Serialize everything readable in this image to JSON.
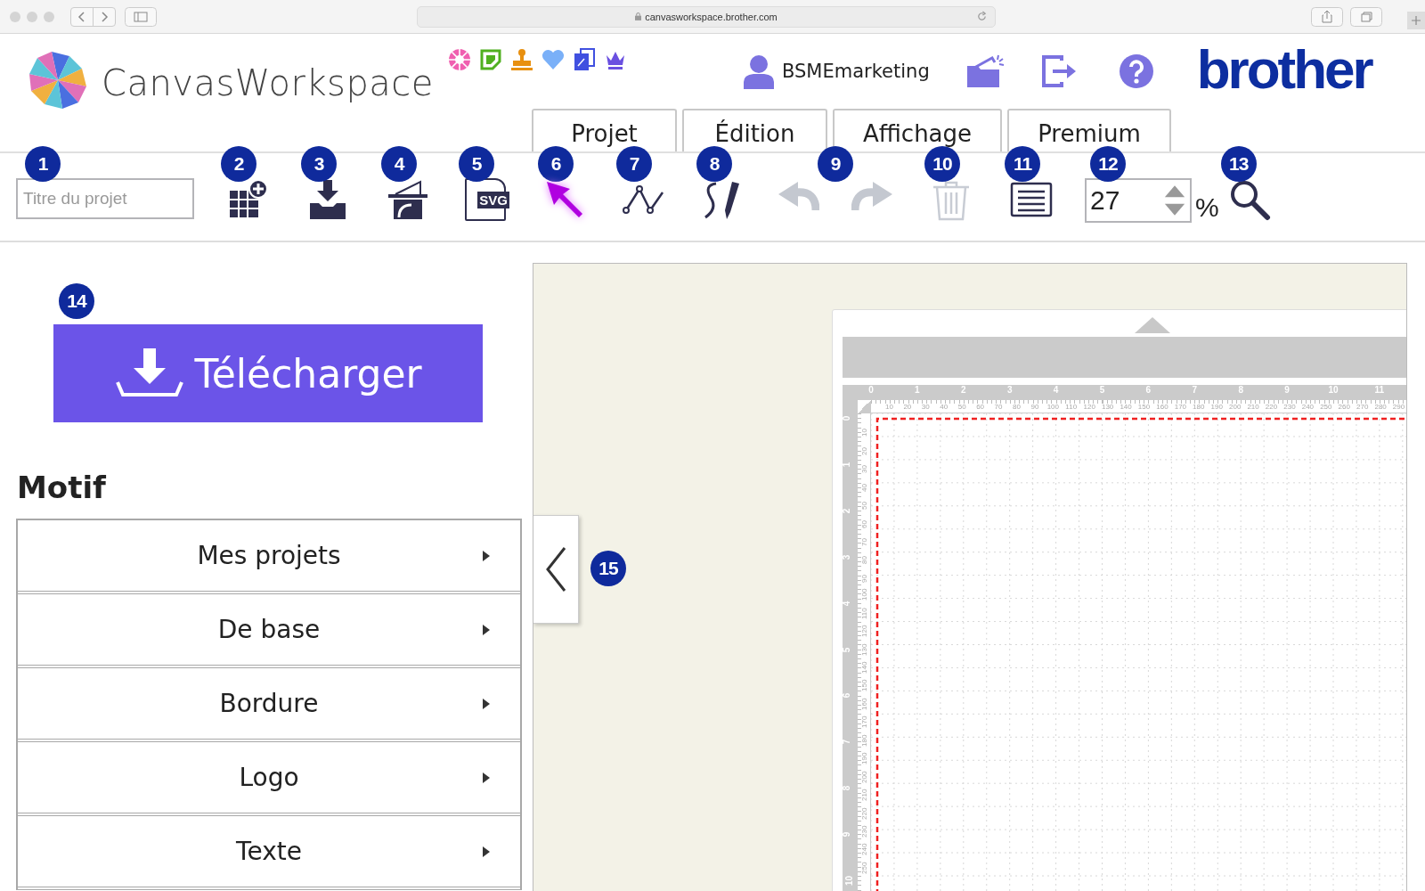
{
  "browser": {
    "url": "canvasworkspace.brother.com"
  },
  "header": {
    "app_name": "CanvasWorkspace",
    "user": "BSMEmarketing",
    "brand": "brother"
  },
  "tabs": [
    {
      "label": "Projet"
    },
    {
      "label": "Édition"
    },
    {
      "label": "Affichage"
    },
    {
      "label": "Premium"
    }
  ],
  "toolbar": [
    {
      "kind": "title_field",
      "badge": "1",
      "placeholder": "Titre du projet"
    },
    {
      "kind": "grid_add",
      "badge": "2"
    },
    {
      "kind": "import",
      "badge": "3"
    },
    {
      "kind": "scan",
      "badge": "4"
    },
    {
      "kind": "svg",
      "badge": "5",
      "icon_text": "SVG"
    },
    {
      "kind": "select",
      "badge": "6"
    },
    {
      "kind": "node",
      "badge": "7"
    },
    {
      "kind": "draw",
      "badge": "8"
    },
    {
      "kind": "undo_redo",
      "badge": "9",
      "disabled": true
    },
    {
      "kind": "trash",
      "badge": "10",
      "disabled": true
    },
    {
      "kind": "list",
      "badge": "11"
    },
    {
      "kind": "zoom_field",
      "badge": "12",
      "value": "27",
      "unit": "%"
    },
    {
      "kind": "search",
      "badge": "13"
    }
  ],
  "sidebar": {
    "badge": "14",
    "download_button": "Télécharger",
    "section_title": "Motif",
    "categories": [
      "Mes projets",
      "De base",
      "Bordure",
      "Logo",
      "Texte"
    ],
    "collapse_badge": "15"
  },
  "canvas": {
    "ruler_x_inches": [
      "0",
      "1",
      "2",
      "3",
      "4",
      "5",
      "6",
      "7",
      "8",
      "9",
      "10",
      "11"
    ],
    "ruler_x_mm": [
      "10",
      "20",
      "30",
      "40",
      "50",
      "60",
      "70",
      "80",
      "90",
      "100",
      "110",
      "120",
      "130",
      "140",
      "150",
      "160",
      "170",
      "180",
      "190",
      "200",
      "210",
      "220",
      "230",
      "240",
      "250",
      "260",
      "270",
      "280",
      "290"
    ],
    "ruler_y_inches": [
      "0",
      "1",
      "2",
      "3",
      "4",
      "5",
      "6",
      "7",
      "8",
      "9",
      "10"
    ],
    "ruler_y_mm": [
      "10",
      "20",
      "30",
      "40",
      "50",
      "60",
      "70",
      "80",
      "90",
      "100",
      "110",
      "120",
      "130",
      "140",
      "150",
      "160",
      "170",
      "180",
      "190",
      "200",
      "210",
      "220",
      "230",
      "240",
      "250"
    ]
  }
}
